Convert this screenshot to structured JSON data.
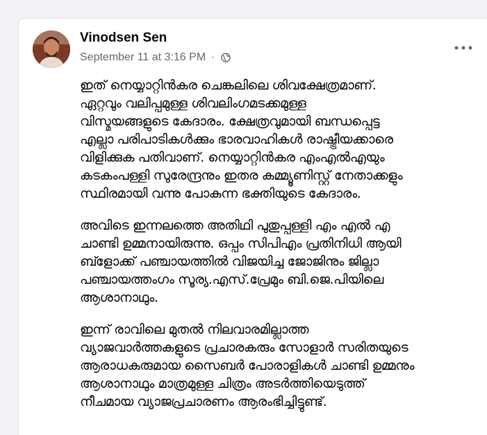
{
  "post": {
    "author": "Vinodsen Sen",
    "timestamp": "September 11 at 3:16 PM",
    "separator": "·",
    "privacy_icon": "globe-icon",
    "more_icon": "more-options-icon",
    "paragraphs": [
      [
        "ഇത് നെയ്യാറ്റിൻകര ചെങ്കലിലെ ശിവക്ഷേത്രമാണ്.",
        "ഏറ്റവും വലിപ്പമുള്ള ശിവലിംഗമടക്കമുള്ള",
        "വിസ്മയങ്ങളുടെ കേദാരം. ക്ഷേത്രവുമായി ബന്ധപ്പെട്ട",
        "എല്ലാ പരിപാടികൾക്കും ഭാരവാഹികൾ രാഷ്ട്രീയക്കാരെ",
        "വിളിക്കുക പതിവാണ്. നെയ്യാറ്റിൻകര എംഎൽഎയും",
        "കടകംപള്ളി സുരേന്ദ്രനും ഇതര കമ്മ്യൂണിസ്റ്റ് നേതാക്കളും",
        "സ്ഥിരമായി വന്നു പോകുന്ന ഭക്തിയുടെ കേദാരം."
      ],
      [
        "അവിടെ ഇന്നലത്തെ അതിഥി പുതുപ്പള്ളി എം എൽ എ",
        "ചാണ്ടി ഉമ്മനായിരുന്നു. ഒപ്പം സിപിഎം പ്രതിനിധി ആയി",
        "ബ്ളോക്ക് പഞ്ചായത്തിൽ വിജയിച്ച ജോജിനും ജില്ലാ",
        "പഞ്ചായത്തംഗം സൂര്യ.എസ്.പ്രേമും ബി.ജെ.പിയിലെ",
        "ആശാനാഥും."
      ],
      [
        "ഇന്ന് രാവിലെ മുതൽ നിലവാരമില്ലാത്ത",
        "വ്യാജവാർത്തകളുടെ പ്രചാരകരും സോളാർ സരിതയുടെ",
        "ആരാധകരുമായ സൈബർ പോരാളികൾ ചാണ്ടി ഉമ്മനും",
        "ആശാനാഥും മാത്രമുള്ള ചിത്രം അടർത്തിയെടുത്ത്",
        "നീചമായ വ്യാജപ്രചാരണം ആരംഭിച്ചിട്ടുണ്ട്."
      ]
    ]
  }
}
